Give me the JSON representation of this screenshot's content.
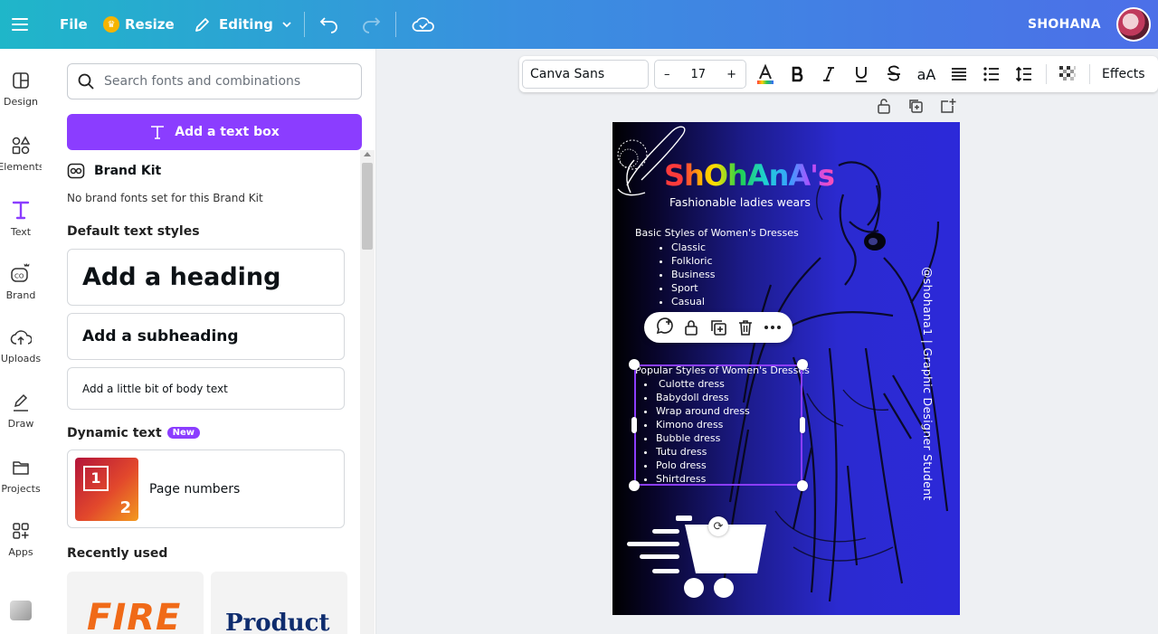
{
  "topbar": {
    "file": "File",
    "resize": "Resize",
    "editing": "Editing",
    "user": "SHOHANA",
    "colors": {
      "accent": "#8b3dff",
      "gradient_start": "#1fb6c9",
      "gradient_end": "#4c6fe8"
    }
  },
  "rail": {
    "items": [
      {
        "label": "Design",
        "icon": "design-icon"
      },
      {
        "label": "Elements",
        "icon": "elements-icon"
      },
      {
        "label": "Text",
        "icon": "text-icon"
      },
      {
        "label": "Brand",
        "icon": "brand-icon"
      },
      {
        "label": "Uploads",
        "icon": "uploads-icon"
      },
      {
        "label": "Draw",
        "icon": "draw-icon"
      },
      {
        "label": "Projects",
        "icon": "projects-icon"
      },
      {
        "label": "Apps",
        "icon": "apps-icon"
      }
    ]
  },
  "panel": {
    "search_placeholder": "Search fonts and combinations",
    "add_text_box": "Add a text box",
    "brand_kit_title": "Brand Kit",
    "brand_kit_note": "No brand fonts set for this Brand Kit",
    "default_styles_title": "Default text styles",
    "heading": "Add a heading",
    "subheading": "Add a subheading",
    "body": "Add a little bit of body text",
    "dynamic_title": "Dynamic text",
    "new_badge": "New",
    "page_numbers": "Page numbers",
    "page_num_1": "1",
    "page_num_2": "2",
    "recently_used_title": "Recently used",
    "recent_1": "FIRE",
    "recent_2": "Product"
  },
  "text_toolbar": {
    "font": "Canva Sans",
    "size": "17",
    "case": "aA",
    "effects": "Effects"
  },
  "design": {
    "brand_name": "ShOhAnA's",
    "tagline": "Fashionable ladies wears",
    "basic_title": "Basic Styles of Women's Dresses",
    "basic_items": [
      "Classic",
      "Folkloric",
      "Business",
      "Sport",
      "Casual"
    ],
    "popular_title": "Popular Styles of Women's Dresses",
    "popular_items": [
      "Culotte dress",
      "Babydoll dress",
      "Wrap around dress",
      "Kimono dress",
      "Bubble dress",
      "Tutu dress",
      "Polo dress",
      "Shirtdress"
    ],
    "vertical_text": "@shohana1 | Graphic Designer Student"
  }
}
